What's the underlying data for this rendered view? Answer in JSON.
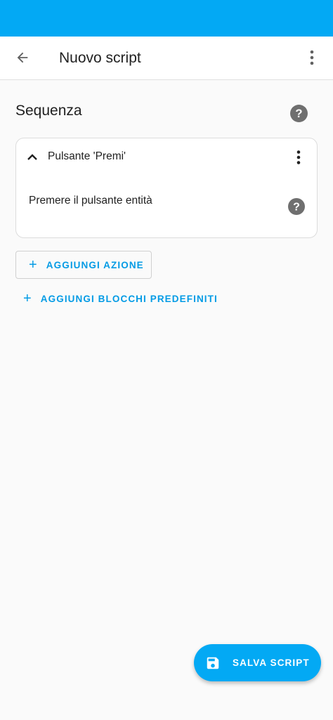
{
  "app_bar": {
    "title": "Nuovo script"
  },
  "section": {
    "title": "Sequenza"
  },
  "action_card": {
    "title": "Pulsante 'Premi'",
    "description": "Premere il pulsante entità"
  },
  "buttons": {
    "add_action": "AGGIUNGI AZIONE",
    "add_blocks": "AGGIUNGI BLOCCHI PREDEFINITI",
    "save_script": "SALVA SCRIPT"
  },
  "icons": {
    "back": "arrow-left-icon",
    "overflow": "dots-vertical-icon",
    "help": "help-circle-icon",
    "collapse": "chevron-up-icon",
    "add": "plus-icon",
    "save": "floppy-disk-icon"
  },
  "colors": {
    "primary": "#03a9f4",
    "accent_text": "#039be5",
    "background": "#fafafa"
  }
}
